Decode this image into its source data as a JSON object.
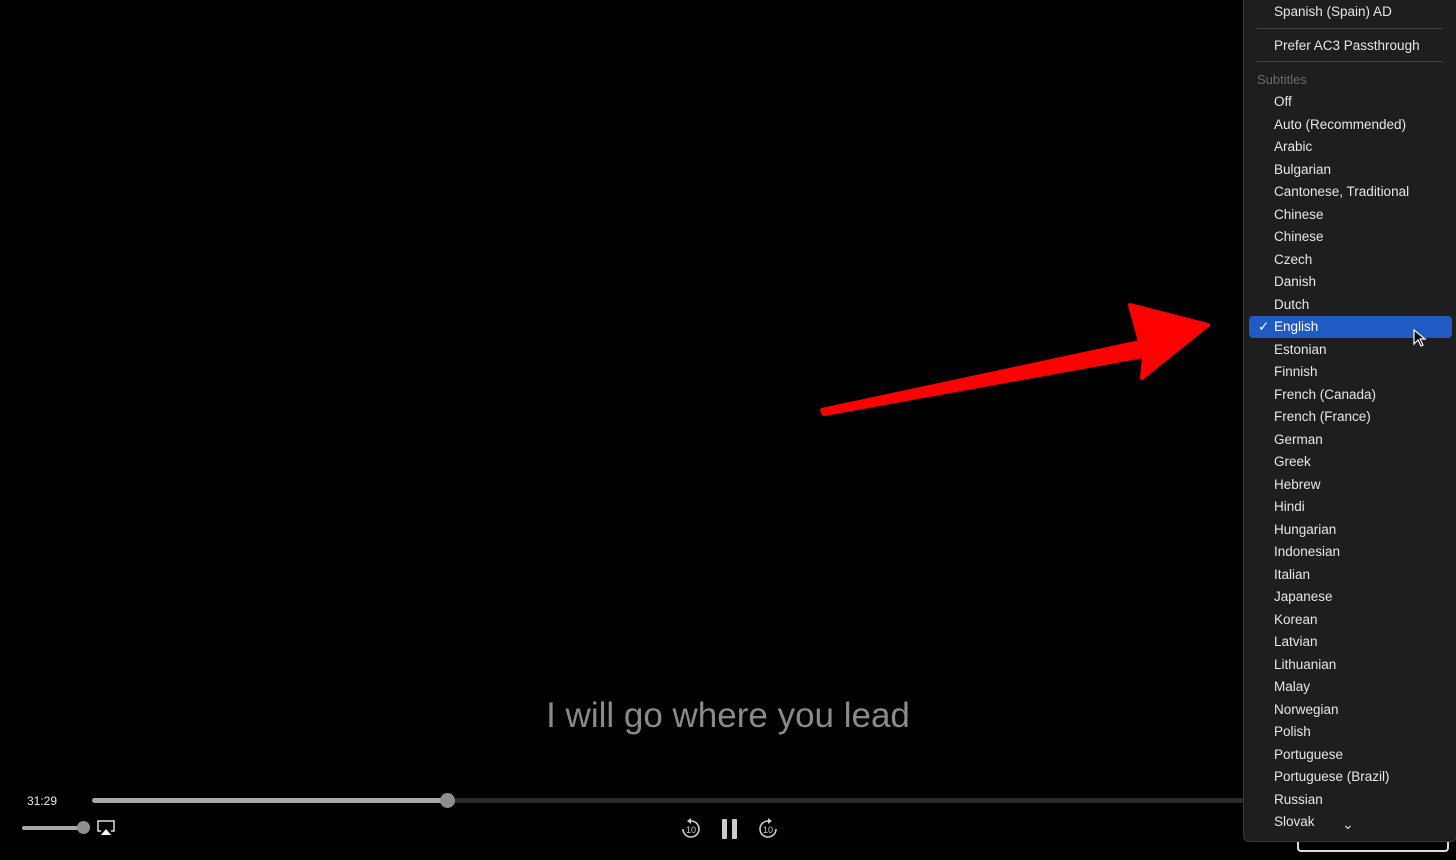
{
  "player": {
    "subtitle_text": "I will go where you lead",
    "elapsed_time": "31:29",
    "progress_fraction": 0.265,
    "volume_fraction": 1.0,
    "icons": [
      "airplay-icon",
      "skip-back-10-icon",
      "pause-icon",
      "skip-forward-10-icon"
    ],
    "skip_label": "10"
  },
  "menu": {
    "audio_items": [
      "Spanish (Spain) AD"
    ],
    "prefer_ac3": "Prefer AC3 Passthrough",
    "subtitles_header": "Subtitles",
    "subtitle_items": [
      "Off",
      "Auto (Recommended)",
      "Arabic",
      "Bulgarian",
      "Cantonese, Traditional",
      "Chinese",
      "Chinese",
      "Czech",
      "Danish",
      "Dutch",
      "English",
      "Estonian",
      "Finnish",
      "French (Canada)",
      "French (France)",
      "German",
      "Greek",
      "Hebrew",
      "Hindi",
      "Hungarian",
      "Indonesian",
      "Italian",
      "Japanese",
      "Korean",
      "Latvian",
      "Lithuanian",
      "Malay",
      "Norwegian",
      "Polish",
      "Portuguese",
      "Portuguese (Brazil)",
      "Russian",
      "Slovak"
    ],
    "selected": "English",
    "checkmark": "✓",
    "scroll_down": "⌄",
    "selection_color": "#1f5bc2"
  },
  "annotation": {
    "arrow_color": "#ff0000"
  }
}
